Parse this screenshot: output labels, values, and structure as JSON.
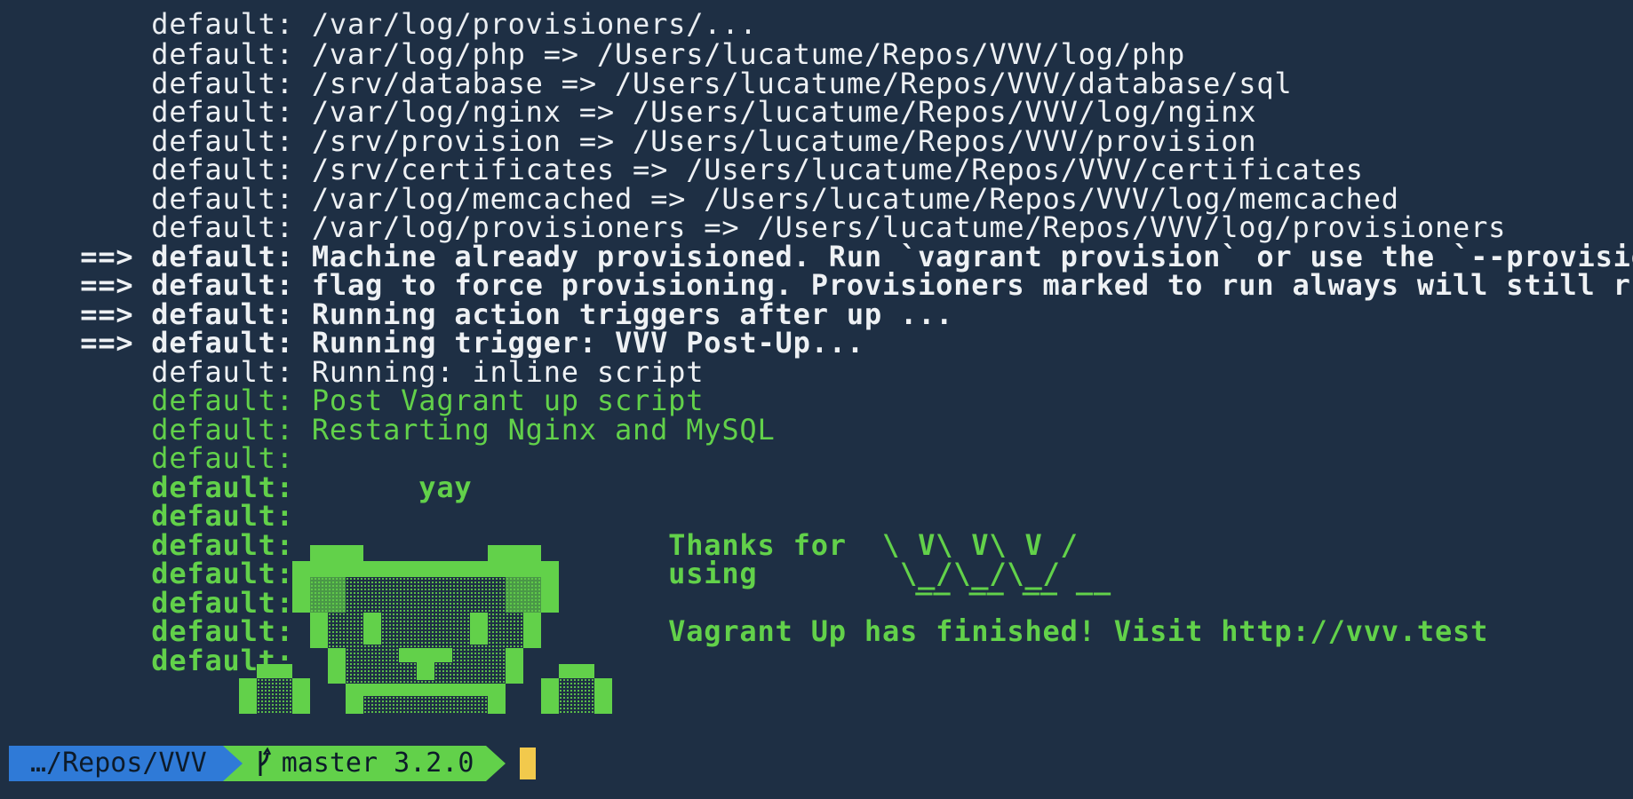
{
  "terminal": {
    "partial_top_line": "default: /var/log/php => /Users/lucatume/Repos/VVV/log/php",
    "lines": [
      {
        "prefix": "",
        "text": "default: /var/log/php => /Users/lucatume/Repos/VVV/log/php"
      },
      {
        "prefix": "",
        "text": "default: /srv/database => /Users/lucatume/Repos/VVV/database/sql"
      },
      {
        "prefix": "",
        "text": "default: /var/log/nginx => /Users/lucatume/Repos/VVV/log/nginx"
      },
      {
        "prefix": "",
        "text": "default: /srv/provision => /Users/lucatume/Repos/VVV/provision"
      },
      {
        "prefix": "",
        "text": "default: /srv/certificates => /Users/lucatume/Repos/VVV/certificates"
      },
      {
        "prefix": "",
        "text": "default: /var/log/memcached => /Users/lucatume/Repos/VVV/log/memcached"
      },
      {
        "prefix": "",
        "text": "default: /var/log/provisioners => /Users/lucatume/Repos/VVV/log/provisioners"
      },
      {
        "prefix": "==>",
        "text": "default: Machine already provisioned. Run `vagrant provision` or use the `--provision`"
      },
      {
        "prefix": "==>",
        "text": "default: flag to force provisioning. Provisioners marked to run always will still run."
      },
      {
        "prefix": "==>",
        "text": "default: Running action triggers after up ..."
      },
      {
        "prefix": "==>",
        "text": "default: Running trigger: VVV Post-Up..."
      },
      {
        "prefix": "",
        "text": "default: Running: inline script"
      },
      {
        "prefix": "",
        "text": "default: Post Vagrant up script"
      },
      {
        "prefix": "",
        "text": "default: Restarting Nginx and MySQL"
      },
      {
        "prefix": "",
        "text": "default:"
      },
      {
        "prefix": "",
        "text": "default:       yay"
      },
      {
        "prefix": "",
        "text": "default:"
      },
      {
        "prefix": "",
        "text": "default:                     Thanks for  \\ V\\ V\\ V /"
      },
      {
        "prefix": "",
        "text": "default:                     using        \\_/\\_/\\_/"
      },
      {
        "prefix": "",
        "text": "default:"
      },
      {
        "prefix": "",
        "text": "default:                     Vagrant Up has finished! Visit http://vvv.test"
      },
      {
        "prefix": "",
        "text": "default:"
      }
    ],
    "vvv_logo_top": "__ __ __ __"
  },
  "prompt": {
    "path": "…/Repos/VVV",
    "branch": "master 3.2.0"
  },
  "colors": {
    "background": "#1e2f44",
    "foreground": "#e9edf1",
    "green": "#62d14a",
    "path_segment": "#2f7ad7",
    "cursor": "#f2c94c"
  }
}
